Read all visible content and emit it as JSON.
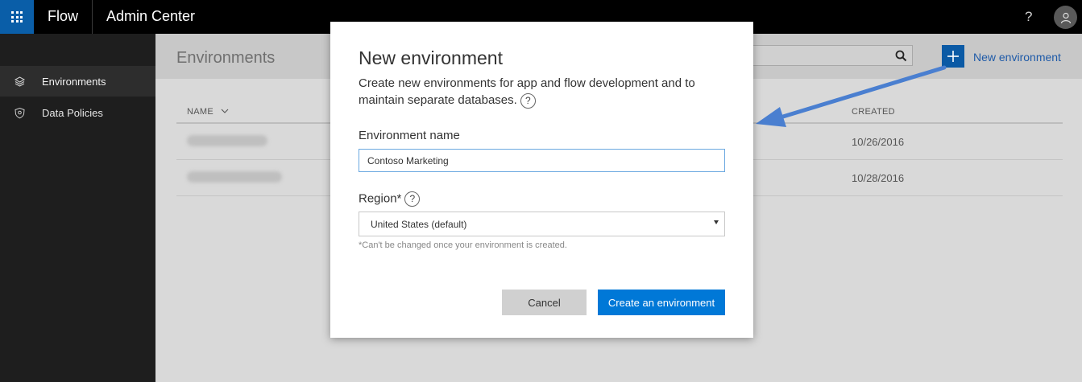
{
  "topbar": {
    "app_name": "Flow",
    "section_title": "Admin Center",
    "help_label": "?"
  },
  "sidebar": {
    "items": [
      {
        "label": "Environments",
        "icon": "layers-icon",
        "active": true
      },
      {
        "label": "Data Policies",
        "icon": "shield-icon",
        "active": false
      }
    ]
  },
  "main": {
    "page_title": "Environments",
    "new_environment_label": "New environment",
    "table": {
      "columns": {
        "name": "NAME",
        "created": "CREATED"
      },
      "rows": [
        {
          "name": "",
          "created": "10/26/2016"
        },
        {
          "name": "",
          "created": "10/28/2016"
        }
      ]
    }
  },
  "modal": {
    "title": "New environment",
    "description": "Create new environments for app and flow development and to maintain separate databases.",
    "help_glyph": "?",
    "name_label": "Environment name",
    "name_value": "Contoso Marketing",
    "region_label": "Region*",
    "region_value": "United States (default)",
    "region_hint": "*Can't be changed once your environment is created.",
    "cancel_label": "Cancel",
    "create_label": "Create an environment"
  },
  "colors": {
    "accent": "#0078d7",
    "brand_tile": "#0a5ea8",
    "annotation_arrow": "#4a7fd0"
  }
}
